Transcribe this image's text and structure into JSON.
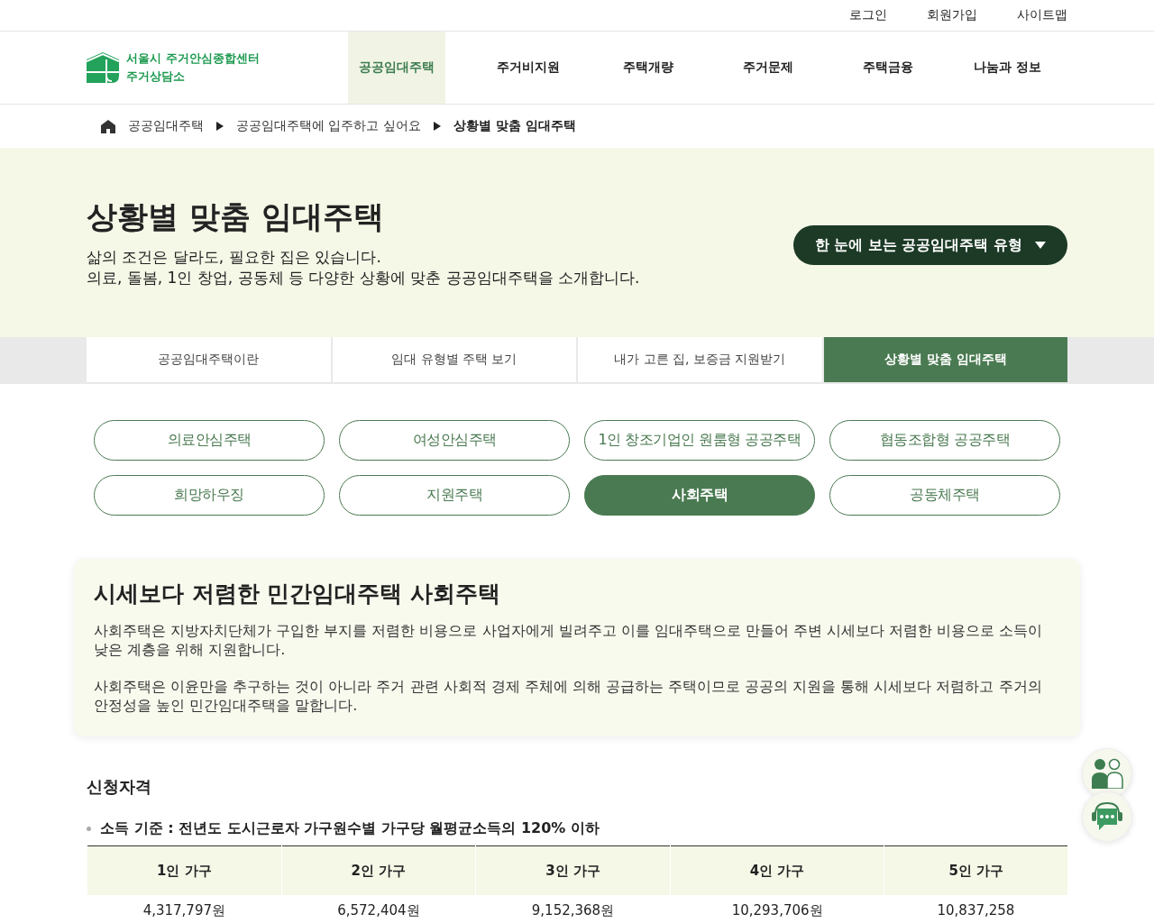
{
  "util_links": [
    "로그인",
    "회원가입",
    "사이트맵"
  ],
  "logo": {
    "line1": "서울시 주거안심종합센터",
    "line2": "주거상담소"
  },
  "nav": [
    {
      "label": "공공임대주택",
      "selected": true
    },
    {
      "label": "주거비지원",
      "selected": false
    },
    {
      "label": "주택개량",
      "selected": false
    },
    {
      "label": "주거문제",
      "selected": false
    },
    {
      "label": "주택금융",
      "selected": false
    },
    {
      "label": "나눔과 정보",
      "selected": false
    }
  ],
  "breadcrumb": [
    "공공임대주택",
    "공공임대주택에 입주하고 싶어요",
    "상황별 맞춤 임대주택"
  ],
  "hero": {
    "title": "상황별 맞춤 임대주택",
    "line1": "삶의 조건은 달라도, 필요한 집은 있습니다.",
    "line2": "의료, 돌봄, 1인 창업, 공동체 등 다양한 상황에 맞춘 공공임대주택을 소개합니다.",
    "button": "한 눈에 보는 공공임대주택 유형"
  },
  "tabs": [
    {
      "label": "공공임대주택이란",
      "selected": false
    },
    {
      "label": "임대 유형별 주택 보기",
      "selected": false
    },
    {
      "label": "내가 고른 집, 보증금 지원받기",
      "selected": false
    },
    {
      "label": "상황별 맞춤 임대주택",
      "selected": true
    }
  ],
  "types": [
    {
      "label": "의료안심주택",
      "selected": false
    },
    {
      "label": "여성안심주택",
      "selected": false
    },
    {
      "label": "1인 창조기업인 원룸형 공공주택",
      "selected": false
    },
    {
      "label": "협동조합형 공공주택",
      "selected": false
    },
    {
      "label": "희망하우징",
      "selected": false
    },
    {
      "label": "지원주택",
      "selected": false
    },
    {
      "label": "사회주택",
      "selected": true
    },
    {
      "label": "공동체주택",
      "selected": false
    }
  ],
  "intro": {
    "title": "시세보다 저렴한 민간임대주택 사회주택",
    "paragraphs": [
      "사회주택은 지방자치단체가 구입한 부지를 저렴한 비용으로 사업자에게 빌려주고 이를 임대주택으로 만들어 주변 시세보다 저렴한 비용으로 소득이 낮은 계층을 위해 지원합니다.",
      "사회주택은 이윤만을 추구하는 것이 아니라 주거 관련 사회적 경제 주체에 의해 공급하는 주택이므로 공공의 지원을 통해 시세보다 저렴하고 주거의 안정성을 높인 민간임대주택을 말합니다."
    ]
  },
  "eligibility": {
    "heading": "신청자격",
    "bullet": "소득 기준 : 전년도 도시근로자 가구원수별 가구당 월평균소득의 120% 이하",
    "table": {
      "columns": [
        "1인 가구",
        "2인 가구",
        "3인 가구",
        "4인 가구",
        "5인 가구"
      ],
      "rows": [
        [
          "4,317,797원",
          "6,572,404원",
          "9,152,368원",
          "10,293,706원",
          "10,837,258"
        ]
      ]
    }
  }
}
